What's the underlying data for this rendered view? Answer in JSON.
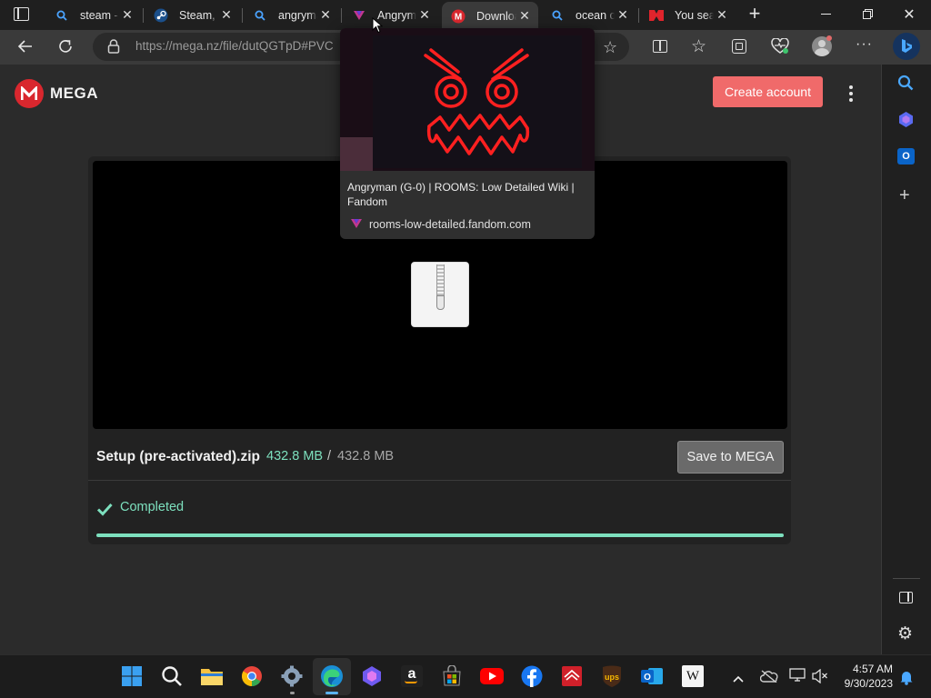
{
  "browser": {
    "tabs": [
      {
        "label": "steam - ",
        "icon": "search-icon"
      },
      {
        "label": "Steam, T",
        "icon": "steam-icon"
      },
      {
        "label": "angryma",
        "icon": "search-icon"
      },
      {
        "label": "Angryma",
        "icon": "fandom-icon"
      },
      {
        "label": "Downloa",
        "icon": "mega-icon",
        "active": true
      },
      {
        "label": "ocean o",
        "icon": "search-icon"
      },
      {
        "label": "You sear",
        "icon": "media-icon"
      }
    ],
    "url": "https://mega.nz/file/dutQGTpD#PVC"
  },
  "hover_card": {
    "title": "Angryman (G-0) | ROOMS: Low Detailed Wiki | Fandom",
    "url": "rooms-low-detailed.fandom.com"
  },
  "page": {
    "brand": "MEGA",
    "create_account_label": "Create account",
    "file_name": "Setup (pre-activated).zip",
    "downloaded": "432.8 MB",
    "separator": "/",
    "total": "432.8 MB",
    "save_label": "Save to MEGA",
    "status": "Completed",
    "progress_percent": 100
  },
  "colors": {
    "mega_red": "#d9272e",
    "accent_green": "#7de0be",
    "create_button": "#f06a6a"
  },
  "taskbar": {
    "time": "4:57 AM",
    "date": "9/30/2023",
    "pinned": [
      "start-icon",
      "search-icon",
      "file-explorer-icon",
      "chrome-icon",
      "settings-icon",
      "edge-icon",
      "copilot-icon",
      "amazon-icon",
      "store-icon",
      "youtube-icon",
      "facebook-icon",
      "bank-icon",
      "ups-icon",
      "outlook-icon",
      "wikipedia-icon"
    ]
  }
}
